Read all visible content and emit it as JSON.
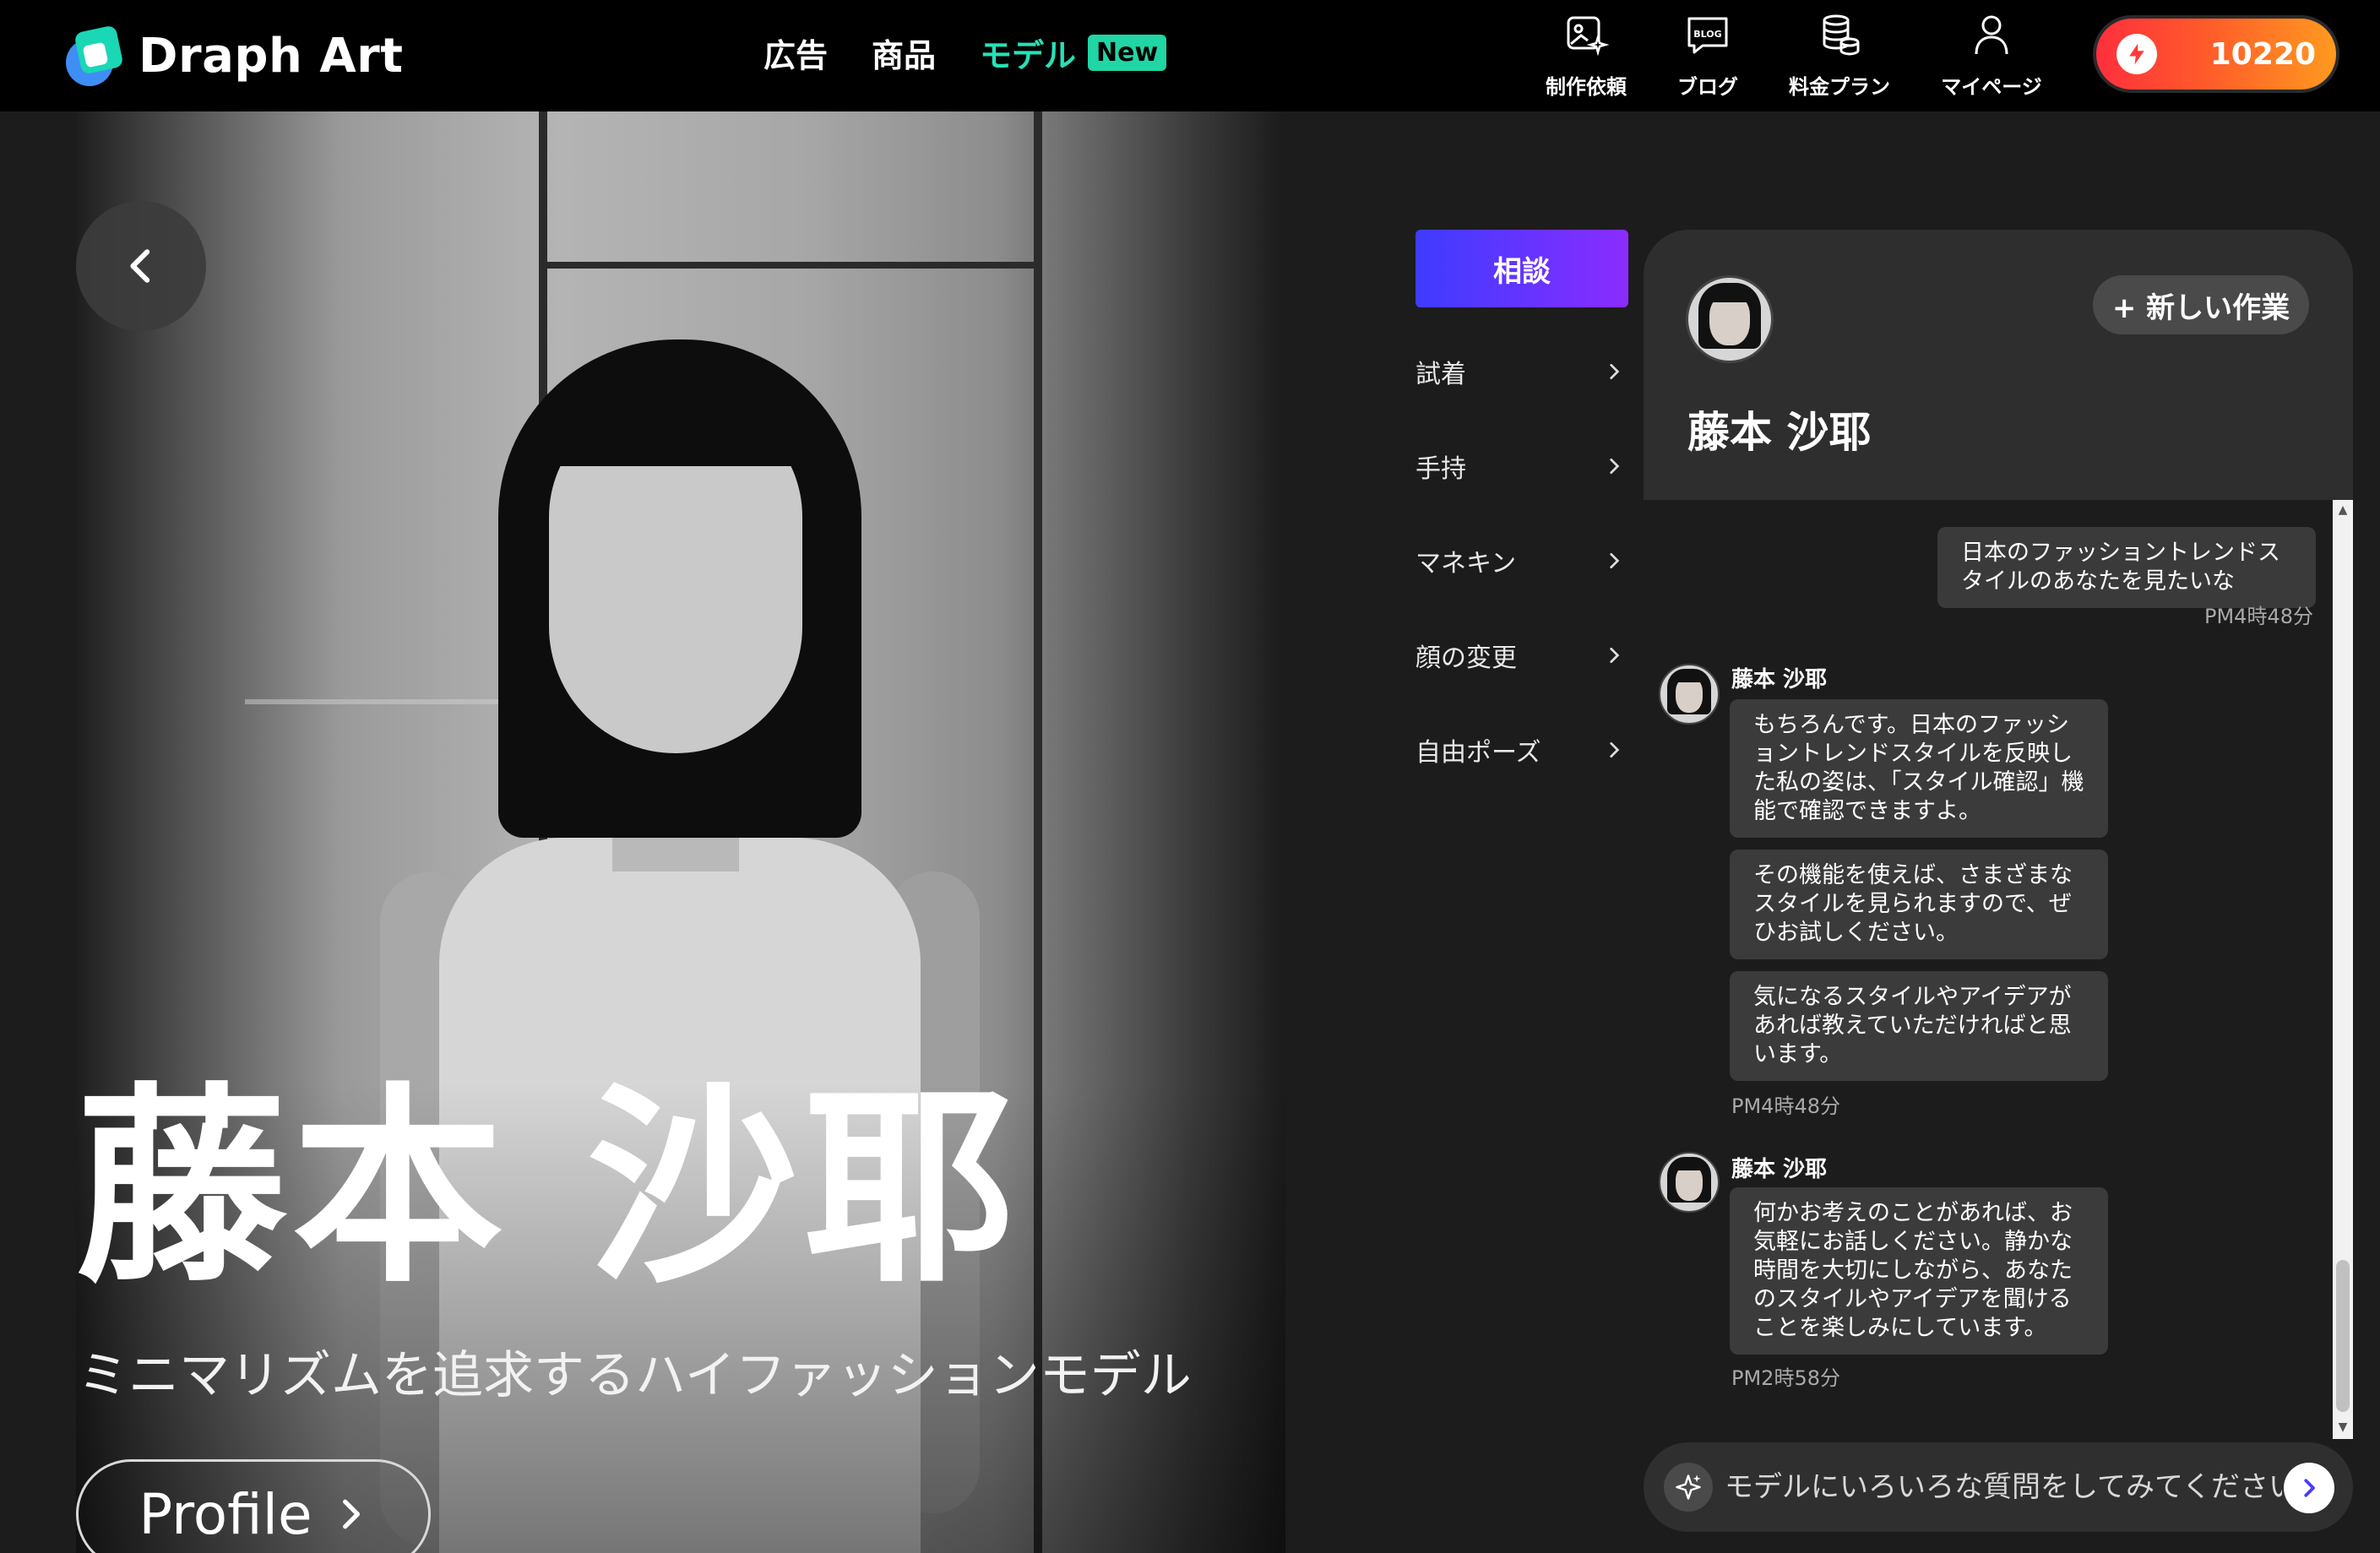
{
  "header": {
    "brand": "Draph Art",
    "nav": [
      {
        "label": "広告"
      },
      {
        "label": "商品"
      },
      {
        "label": "モデル",
        "badge": "New"
      }
    ],
    "utilities": [
      {
        "label": "制作依頼",
        "icon": "image-request-icon"
      },
      {
        "label": "ブログ",
        "icon": "blog-icon",
        "icon_text": "BLOG"
      },
      {
        "label": "料金プラン",
        "icon": "coins-icon"
      },
      {
        "label": "マイページ",
        "icon": "user-icon"
      }
    ],
    "credits": "10220",
    "colors": {
      "accent": "#27e1b6",
      "badge": "#1fd6a4",
      "credit_start": "#ff2f3d",
      "credit_end": "#ff9a1f"
    }
  },
  "hero": {
    "name": "藤本 沙耶",
    "tagline": "ミニマリズムを追求するハイファッションモデル",
    "profile_button": "Profile"
  },
  "menu": {
    "active": "相談",
    "items": [
      {
        "label": "試着"
      },
      {
        "label": "手持"
      },
      {
        "label": "マネキン"
      },
      {
        "label": "顔の変更"
      },
      {
        "label": "自由ポーズ"
      }
    ],
    "colors": {
      "active_start": "#3e3cff",
      "active_end": "#8a2cff"
    }
  },
  "chat": {
    "model_name": "藤本 沙耶",
    "new_task": "+ 新しい作業",
    "messages": [
      {
        "from": "user",
        "lines": [
          "日本のファッショントレンドス",
          "タイルのあなたを見たいな"
        ],
        "time": "PM4時48分"
      },
      {
        "from": "model",
        "sender": "藤本 沙耶",
        "bubbles": [
          [
            "もちろんです。日本のファッシ",
            "ョントレンドスタイルを反映し",
            "た私の姿は、「スタイル確認」機",
            "能で確認できますよ。"
          ],
          [
            "その機能を使えば、さまざまな",
            "スタイルを見られますので、ぜ",
            "ひお試しください。"
          ],
          [
            "気になるスタイルやアイデアが",
            "あれば教えていただければと思",
            "います。"
          ]
        ],
        "time": "PM4時48分"
      },
      {
        "from": "model",
        "sender": "藤本 沙耶",
        "bubbles": [
          [
            "何かお考えのことがあれば、お",
            "気軽にお話しください。静かな",
            "時間を大切にしながら、あなた",
            "のスタイルやアイデアを聞ける",
            "ことを楽しみにしています。"
          ]
        ],
        "time": "PM2時58分"
      }
    ],
    "input_placeholder": "モデルにいろいろな質問をしてみてください"
  }
}
